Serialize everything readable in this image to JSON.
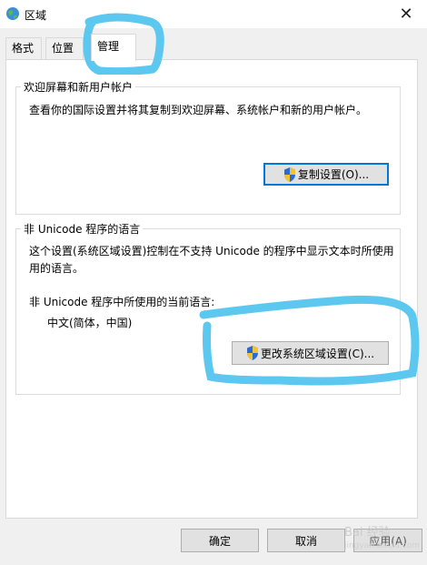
{
  "window": {
    "title": "区域",
    "close_glyph": "✕"
  },
  "tabs": [
    {
      "label": "格式",
      "active": false
    },
    {
      "label": "位置",
      "active": false
    },
    {
      "label": "管理",
      "active": true
    }
  ],
  "welcome_group": {
    "title": "欢迎屏幕和新用户帐户",
    "description": "查看你的国际设置并将其复制到欢迎屏幕、系统帐户和新的用户帐户。",
    "copy_button_label": "复制设置(O)..."
  },
  "unicode_group": {
    "title": "非 Unicode 程序的语言",
    "description_line1": "这个设置(系统区域设置)控制在不支持 Unicode 的程序中显示文本时所使用",
    "description_line2": "用的语言。",
    "current_label": "非 Unicode 程序中所使用的当前语言:",
    "current_value": "中文(简体，中国)",
    "change_button_label": "更改系统区域设置(C)..."
  },
  "footer": {
    "ok_label": "确定",
    "cancel_label": "取消",
    "apply_label": "应用(A)"
  },
  "watermark": {
    "text": "Bai 经验",
    "sub": "jingyan.baidu.com"
  },
  "colors": {
    "annotation": "#5cc8f0",
    "focus": "#0078d7",
    "shield_blue": "#2a6ad4",
    "shield_yellow": "#f2c230"
  }
}
